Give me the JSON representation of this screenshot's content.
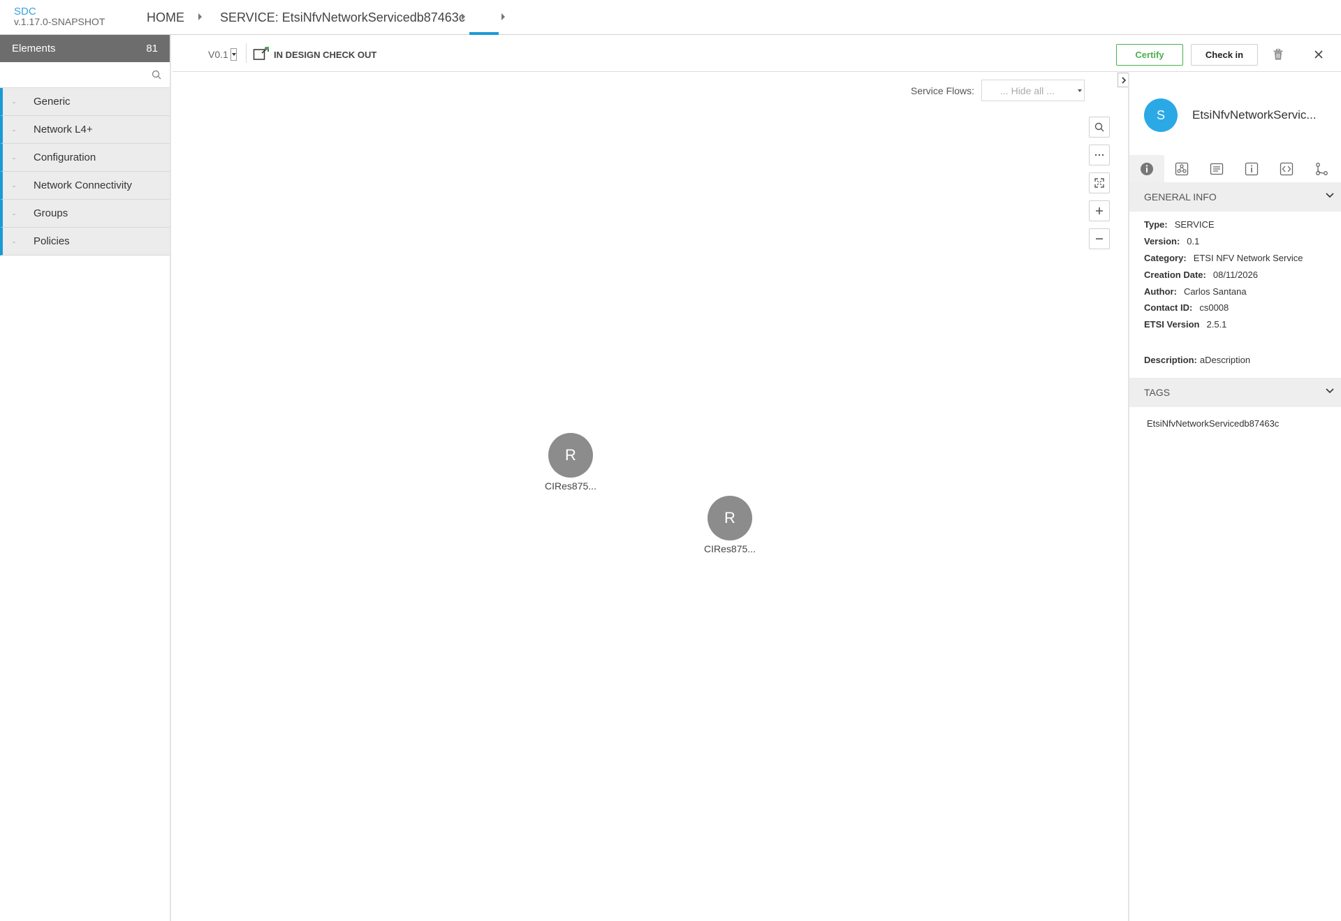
{
  "header": {
    "app_name": "SDC",
    "app_version": "v.1.17.0-SNAPSHOT",
    "breadcrumbs": [
      "HOME",
      "SERVICE: EtsiNfvNetworkServicedb87463c"
    ]
  },
  "palette": {
    "title": "Elements",
    "count": "81",
    "search_placeholder": "",
    "items": [
      {
        "label": "Generic"
      },
      {
        "label": "Network L4+"
      },
      {
        "label": "Configuration"
      },
      {
        "label": "Network Connectivity"
      },
      {
        "label": "Groups"
      },
      {
        "label": "Policies"
      }
    ]
  },
  "toolbar": {
    "version": "V0.1",
    "status": "IN DESIGN CHECK OUT",
    "certify_label": "Certify",
    "checkin_label": "Check in"
  },
  "canvas": {
    "service_flows_label": "Service Flows:",
    "service_flows_value": "... Hide all ...",
    "nodes": [
      {
        "letter": "R",
        "label": "CIRes875..."
      },
      {
        "letter": "R",
        "label": "CIRes875..."
      }
    ]
  },
  "panel": {
    "avatar_letter": "S",
    "title": "EtsiNfvNetworkServic...",
    "general_info_title": "GENERAL INFO",
    "info": [
      {
        "key": "Type:",
        "value": "SERVICE"
      },
      {
        "key": "Version:",
        "value": "0.1"
      },
      {
        "key": "Category:",
        "value": "ETSI NFV Network Service"
      },
      {
        "key": "Creation Date:",
        "value": "08/11/2026"
      },
      {
        "key": "Author:",
        "value": "Carlos Santana"
      },
      {
        "key": "Contact ID:",
        "value": "cs0008"
      },
      {
        "key": "ETSI Version",
        "value": "2.5.1"
      }
    ],
    "description_key": "Description:",
    "description_value": "aDescription",
    "tags_title": "TAGS",
    "tags": [
      "EtsiNfvNetworkServicedb87463c"
    ]
  },
  "colors": {
    "accent": "#1a9ad6",
    "certify": "#4caf50",
    "avatar": "#2aa9e6",
    "node": "#8c8c8c",
    "palette_header": "#6d6d6d"
  }
}
